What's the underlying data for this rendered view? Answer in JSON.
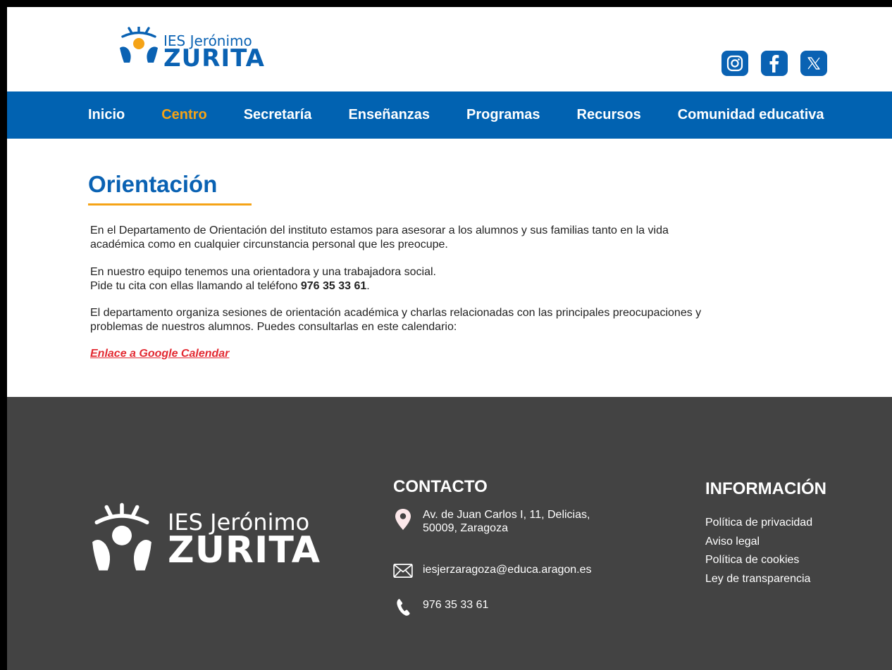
{
  "header": {
    "logo": {
      "line1": "IES Jerónimo",
      "line2": "ZURITA"
    },
    "social": [
      {
        "name": "instagram",
        "icon": "instagram-icon"
      },
      {
        "name": "facebook",
        "icon": "facebook-icon"
      },
      {
        "name": "x",
        "icon": "x-icon"
      }
    ]
  },
  "nav": {
    "items": [
      {
        "label": "Inicio",
        "active": false
      },
      {
        "label": "Centro",
        "active": true
      },
      {
        "label": "Secretaría",
        "active": false
      },
      {
        "label": "Enseñanzas",
        "active": false
      },
      {
        "label": "Programas",
        "active": false
      },
      {
        "label": "Recursos",
        "active": false
      },
      {
        "label": "Comunidad educativa",
        "active": false
      }
    ]
  },
  "main": {
    "title": "Orientación",
    "paragraph1": "En el Departamento de Orientación del instituto estamos para asesorar a los alumnos y sus familias tanto en la vida académica como en cualquier circunstancia personal que les preocupe.",
    "paragraph2_line1": "En nuestro equipo tenemos una orientadora y una trabajadora social.",
    "paragraph2_line2_prefix": "Pide tu cita con ellas llamando al teléfono ",
    "paragraph2_phone": "976 35 33 61",
    "paragraph2_suffix": ".",
    "paragraph3": "El departamento organiza sesiones de orientación académica y charlas relacionadas con las principales preocupaciones y problemas de nuestros alumnos. Puedes consultarlas en este calendario:",
    "calendar_link": "Enlace a Google Calendar"
  },
  "footer": {
    "logo": {
      "line1": "IES Jerónimo",
      "line2": "ZURITA"
    },
    "contact_heading": "CONTACTO",
    "address_line1": "Av. de Juan Carlos I, 11, Delicias,",
    "address_line2": "50009, Zaragoza",
    "email": "iesjerzaragoza@educa.aragon.es",
    "phone": "976 35 33 61",
    "info_heading": "INFORMACIÓN",
    "info_links": [
      "Política de privacidad",
      "Aviso legal",
      "Política de cookies",
      "Ley de transparencia"
    ]
  },
  "colors": {
    "brand_blue": "#0162b1",
    "accent_orange": "#f5a316",
    "link_red": "#e32a32",
    "footer_bg": "#434343"
  }
}
